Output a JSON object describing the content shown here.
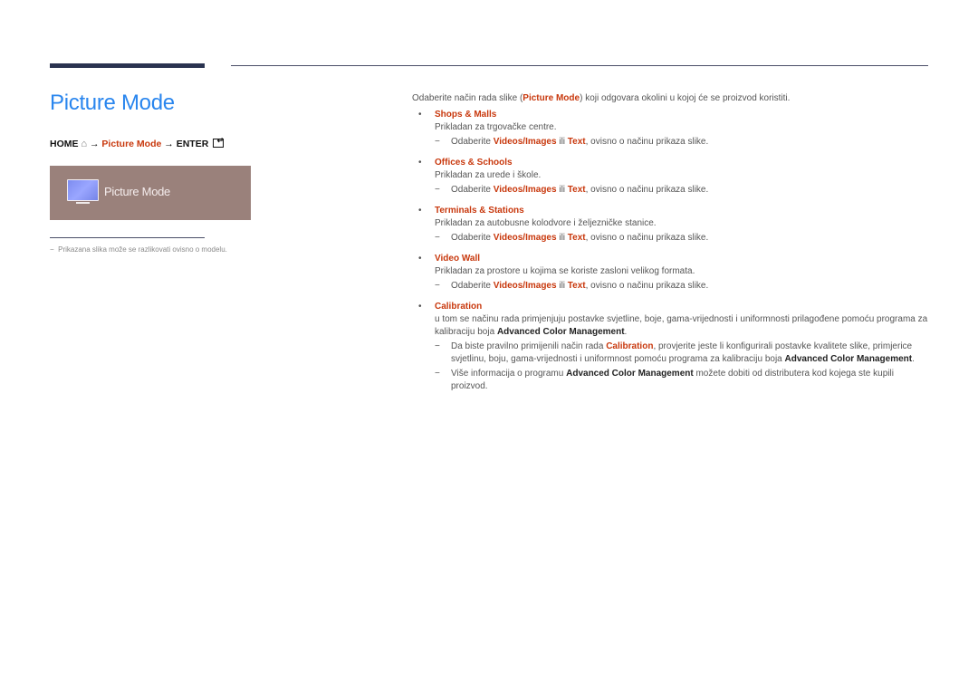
{
  "header": {
    "title": "Picture Mode"
  },
  "path": {
    "home": "HOME",
    "home_icon": "house-icon",
    "arrow": "→",
    "picture_mode": "Picture Mode",
    "enter": "ENTER",
    "enter_icon": "enter-icon"
  },
  "osd": {
    "icon": "monitor-icon",
    "label": "Picture Mode"
  },
  "note": {
    "dash": "−",
    "text": "Prikazana slika može se razlikovati ovisno o modelu."
  },
  "intro": {
    "pre": "Odaberite način rada slike (",
    "hl": "Picture Mode",
    "post": ") koji odgovara okolini u kojoj će se proizvod koristiti."
  },
  "common_sub": {
    "pre": "Odaberite ",
    "hl1": "Videos/Images",
    "mid": " ili ",
    "hl2": "Text",
    "post": ", ovisno o načinu prikaza slike."
  },
  "items": [
    {
      "head": "Shops & Malls",
      "desc": "Prikladan za trgovačke centre."
    },
    {
      "head": "Offices & Schools",
      "desc": "Prikladan za urede i škole."
    },
    {
      "head": "Terminals & Stations",
      "desc": "Prikladan za autobusne kolodvore i željezničke stanice."
    },
    {
      "head": "Video Wall",
      "desc": "Prikladan za prostore u kojima se koriste zasloni velikog formata."
    }
  ],
  "calibration": {
    "head": "Calibration",
    "desc_pre": "u tom se načinu rada primjenjuju postavke svjetline, boje, gama-vrijednosti i uniformnosti prilagođene pomoću programa za kalibraciju boja ",
    "desc_k": "Advanced Color Management",
    "desc_post": ".",
    "sub1_pre": "Da biste pravilno primijenili način rada ",
    "sub1_hl": "Calibration",
    "sub1_mid": ", provjerite jeste li konfigurirali postavke kvalitete slike, primjerice svjetlinu, boju, gama-vrijednosti i uniformnost pomoću programa za kalibraciju boja ",
    "sub1_k": "Advanced Color Management",
    "sub1_post": ".",
    "sub2_pre": "Više informacija o programu ",
    "sub2_k": "Advanced Color Management",
    "sub2_post": " možete dobiti od distributera kod kojega ste kupili proizvod."
  },
  "bullet": "•",
  "dash": "−"
}
